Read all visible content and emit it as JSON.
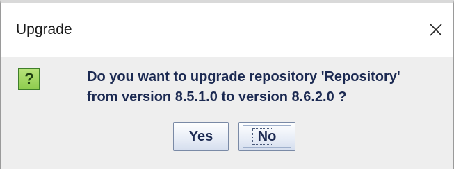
{
  "window": {
    "title": "Upgrade",
    "close_icon": "close-icon"
  },
  "dialog": {
    "icon": "question-icon",
    "icon_glyph": "?",
    "message_line1": "Do you want to upgrade repository 'Repository'",
    "message_line2": "from version 8.5.1.0 to version 8.6.2.0 ?"
  },
  "buttons": {
    "yes_label": "Yes",
    "no_label": "No"
  },
  "colors": {
    "title_bg": "#ffffff",
    "body_bg": "#eeeeee",
    "text": "#1c2a52",
    "icon_green": "#8fcd4f"
  }
}
